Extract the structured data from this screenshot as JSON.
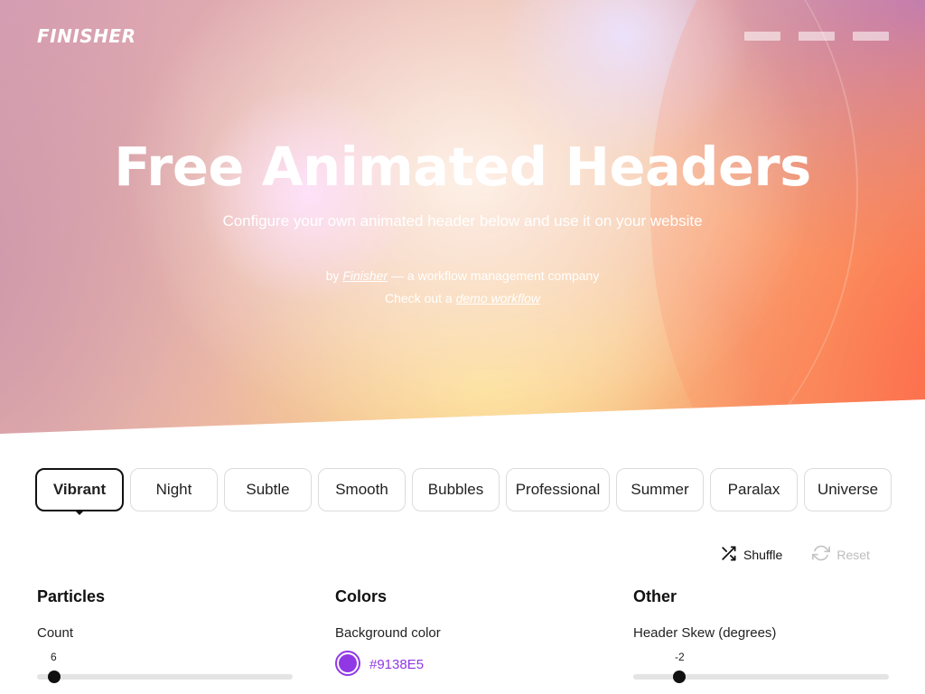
{
  "brand": {
    "logo": "FINISHER"
  },
  "hero": {
    "title": "Free Animated Headers",
    "subtitle": "Configure your own animated header below and use it on your website",
    "by_prefix": "by",
    "by_link": "Finisher",
    "by_suffix": "— a workflow management company",
    "demo_prefix": "Check out a",
    "demo_link": "demo workflow"
  },
  "tabs": [
    {
      "label": "Vibrant",
      "active": true
    },
    {
      "label": "Night"
    },
    {
      "label": "Subtle"
    },
    {
      "label": "Smooth"
    },
    {
      "label": "Bubbles"
    },
    {
      "label": "Professional"
    },
    {
      "label": "Summer"
    },
    {
      "label": "Paralax"
    },
    {
      "label": "Universe"
    }
  ],
  "actions": {
    "shuffle": "Shuffle",
    "reset": "Reset"
  },
  "sections": {
    "particles": {
      "title": "Particles",
      "count_label": "Count",
      "count_value": "6"
    },
    "colors": {
      "title": "Colors",
      "bg_label": "Background color",
      "bg_value": "#9138E5"
    },
    "other": {
      "title": "Other",
      "skew_label": "Header Skew (degrees)",
      "skew_value": "-2"
    }
  },
  "colors": {
    "accent": "#9138E5",
    "active_tab_border": "#111111"
  }
}
